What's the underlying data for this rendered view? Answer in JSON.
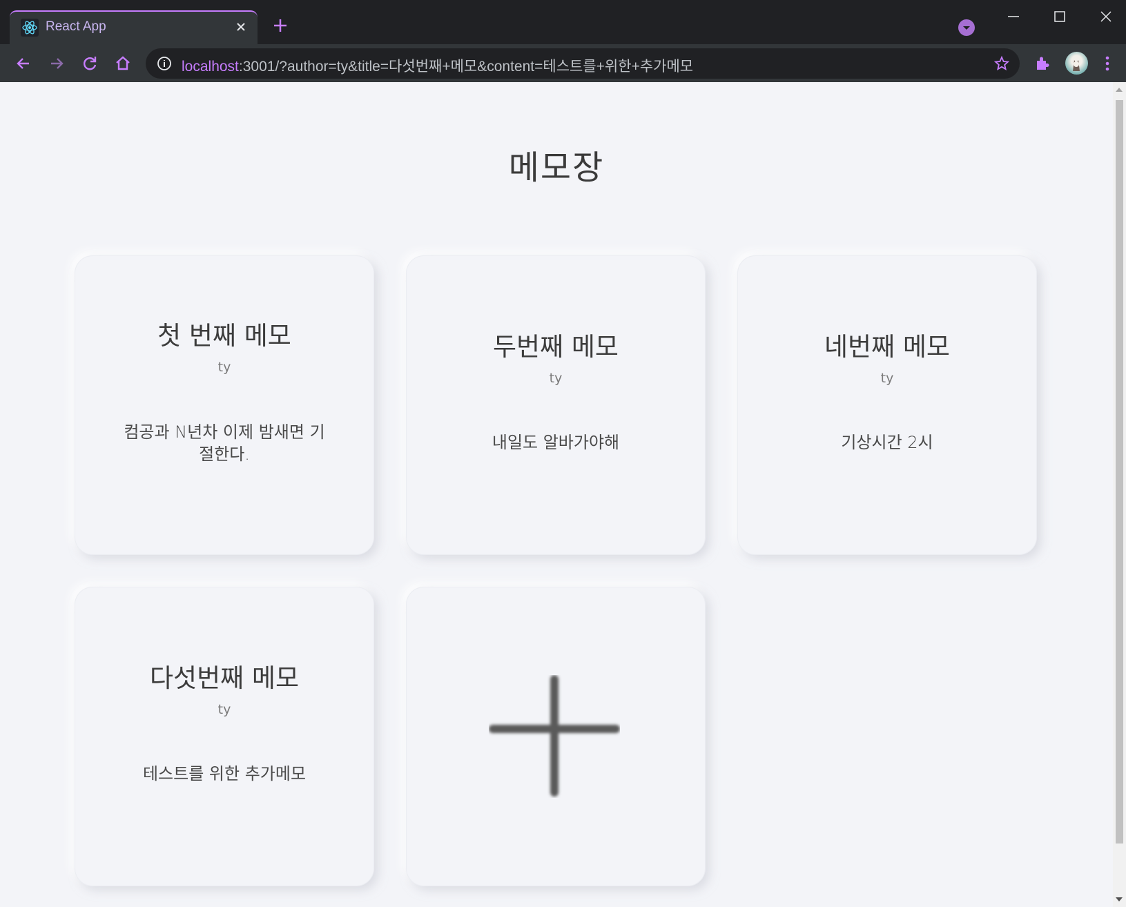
{
  "browser": {
    "tab_title": "React App",
    "url_host": "localhost",
    "url_rest": ":3001/?author=ty&title=다섯번째+메모&content=테스트를+위한+추가메모",
    "accent_color": "#c77dff"
  },
  "page": {
    "title": "메모장"
  },
  "memos": [
    {
      "title": "첫 번째 메모",
      "author": "ty",
      "content_line1": "컴공과 N년차 이제 밤새면 기",
      "content_line2": "절한다."
    },
    {
      "title": "두번째 메모",
      "author": "ty",
      "content_line1": "내일도 알바가야해",
      "content_line2": ""
    },
    {
      "title": "네번째 메모",
      "author": "ty",
      "content_line1": "기상시간 2시",
      "content_line2": ""
    },
    {
      "title": "다섯번째 메모",
      "author": "ty",
      "content_line1": "테스트를 위한 추가메모",
      "content_line2": ""
    }
  ],
  "icons": {
    "add": "plus-icon"
  }
}
